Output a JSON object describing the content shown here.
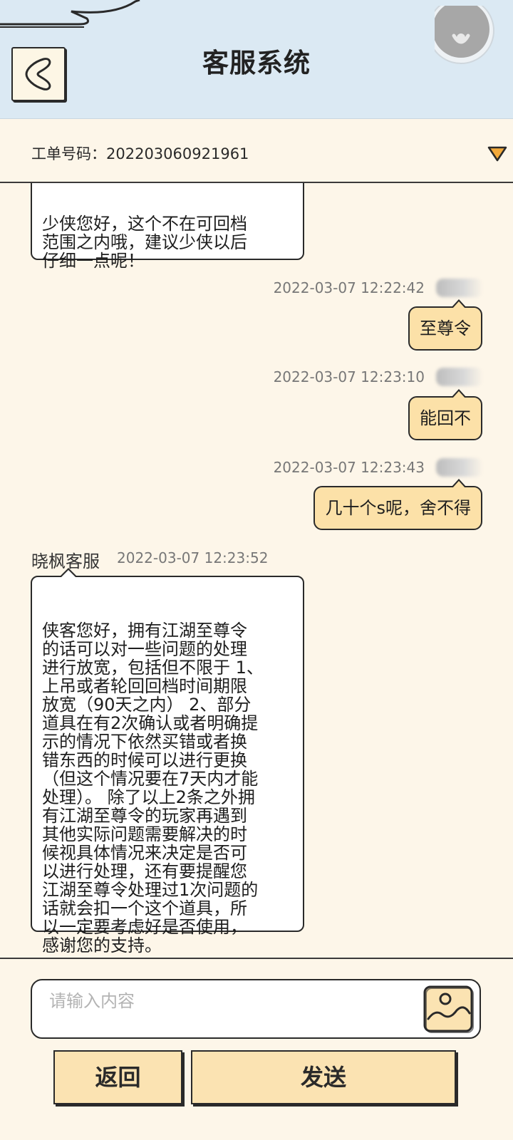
{
  "header": {
    "title": "客服系统",
    "back_icon": "chevron-left-icon",
    "avatar_icon": "avatar-icon"
  },
  "ticket": {
    "label": "工单号码：202203060921961",
    "toggle_icon": "triangle-down-icon"
  },
  "messages": [
    {
      "side": "left",
      "text": "少侠您好，这个不在可回档\n范围之内哦，建议少侠以后\n仔细一点呢！"
    },
    {
      "side": "right",
      "time": "2022-03-07 12:22:42",
      "text": "至尊令"
    },
    {
      "side": "right",
      "time": "2022-03-07 12:23:10",
      "text": "能回不"
    },
    {
      "side": "right",
      "time": "2022-03-07 12:23:43",
      "text": "几十个s呢，舍不得"
    },
    {
      "side": "left",
      "sender": "晓枫客服",
      "time": "2022-03-07 12:23:52",
      "text": "侠客您好，拥有江湖至尊令\n的话可以对一些问题的处理\n进行放宽，包括但不限于 1、\n上吊或者轮回回档时间期限\n放宽（90天之内） 2、部分\n道具在有2次确认或者明确提\n示的情况下依然买错或者换\n错东西的时候可以进行更换\n（但这个情况要在7天内才能\n处理）。 除了以上2条之外拥\n有江湖至尊令的玩家再遇到\n其他实际问题需要解决的时\n候视具体情况来决定是否可\n以进行处理，还有要提醒您\n江湖至尊令处理过1次问题的\n话就会扣一个这个道具，所\n以一定要考虑好是否使用，\n感谢您的支持。"
    }
  ],
  "input": {
    "placeholder": "请输入内容",
    "value": "",
    "image_icon": "image-icon"
  },
  "buttons": {
    "back": "返回",
    "send": "发送"
  },
  "colors": {
    "header_bg": "#dbe9f3",
    "page_bg": "#fdf6e9",
    "user_bubble": "#fce1a8",
    "button_bg": "#fbe3b2"
  }
}
